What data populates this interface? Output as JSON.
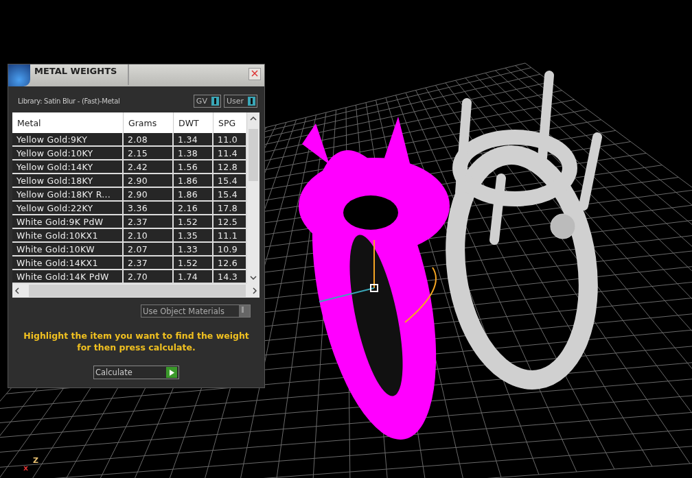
{
  "dialog": {
    "title": "METAL WEIGHTS",
    "library": "Library: Satin Blur - (Fast)-Metal",
    "toggles": [
      {
        "label": "GV",
        "on": true
      },
      {
        "label": "User",
        "on": true
      }
    ],
    "table": {
      "columns": [
        "Metal",
        "Grams",
        "DWT",
        "SPG"
      ],
      "rows": [
        [
          "Yellow Gold:9KY",
          "2.08",
          "1.34",
          "11.0"
        ],
        [
          "Yellow Gold:10KY",
          "2.15",
          "1.38",
          "11.4"
        ],
        [
          "Yellow Gold:14KY",
          "2.42",
          "1.56",
          "12.8"
        ],
        [
          "Yellow Gold:18KY",
          "2.90",
          "1.86",
          "15.4"
        ],
        [
          "Yellow Gold:18KY R...",
          "2.90",
          "1.86",
          "15.4"
        ],
        [
          "Yellow Gold:22KY",
          "3.36",
          "2.16",
          "17.8"
        ],
        [
          "White Gold:9K PdW",
          "2.37",
          "1.52",
          "12.5"
        ],
        [
          "White Gold:10KX1",
          "2.10",
          "1.35",
          "11.1"
        ],
        [
          "White Gold:10KW",
          "2.07",
          "1.33",
          "10.9"
        ],
        [
          "White Gold:14KX1",
          "2.37",
          "1.52",
          "12.6"
        ],
        [
          "White Gold:14K PdW",
          "2.70",
          "1.74",
          "14.3"
        ]
      ]
    },
    "use_object_materials": {
      "label": "Use Object Materials",
      "on": false
    },
    "hint": "Highlight the item you want to find the weight for then press calculate.",
    "calculate_button": "Calculate"
  },
  "viewport": {
    "axis_labels": [
      "x",
      "Z"
    ]
  }
}
